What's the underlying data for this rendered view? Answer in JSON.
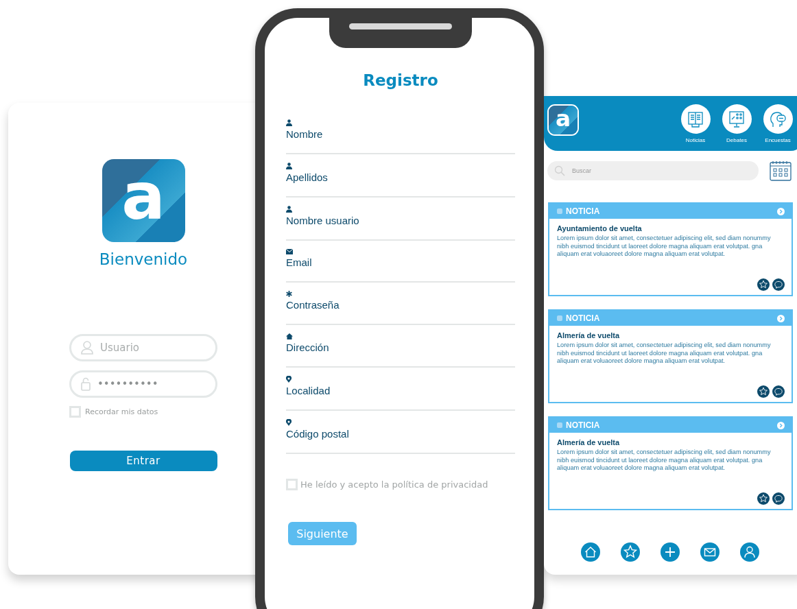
{
  "login": {
    "logo": "a",
    "title": "Bienvenido",
    "username": {
      "placeholder": "Usuario"
    },
    "password": {
      "value": "••••••••••"
    },
    "remember": {
      "label": "Recordar mis datos",
      "checked": false
    },
    "submit": "Entrar"
  },
  "register": {
    "title": "Registro",
    "fields": [
      {
        "kind": "person",
        "label": "Nombre"
      },
      {
        "kind": "person",
        "label": "Apellidos"
      },
      {
        "kind": "person",
        "label": "Nombre usuario"
      },
      {
        "kind": "mail",
        "label": "Email"
      },
      {
        "kind": "star",
        "label": "Contraseña"
      },
      {
        "kind": "home",
        "label": "Dirección"
      },
      {
        "kind": "pin",
        "label": "Localidad"
      },
      {
        "kind": "pin",
        "label": "Código postal"
      }
    ],
    "privacy": {
      "label": "He leído y acepto la política de privacidad",
      "checked": false
    },
    "next": "Siguiente"
  },
  "feed": {
    "logo": "a",
    "nav": [
      {
        "kind": "news",
        "label": "Noticias"
      },
      {
        "kind": "debate",
        "label": "Debates"
      },
      {
        "kind": "survey",
        "label": "Encuestas"
      }
    ],
    "search": {
      "placeholder": "Buscar"
    },
    "cards": [
      {
        "tag": "NOTICIA",
        "title": "Ayuntamiento de vuelta",
        "body": "Lorem ipsum dolor sit amet, consectetuer adipiscing elit, sed diam nonummy nibh euismod tincidunt ut laoreet dolore magna aliquam erat volutpat. gna aliquam erat voluaoreet dolore magna aliquam erat volutpat."
      },
      {
        "tag": "NOTICIA",
        "title": "Almería de vuelta",
        "body": "Lorem ipsum dolor sit amet, consectetuer adipiscing elit, sed diam nonummy nibh euismod tincidunt ut laoreet dolore magna aliquam erat volutpat. gna aliquam erat voluaoreet dolore magna aliquam erat volutpat."
      },
      {
        "tag": "NOTICIA",
        "title": "Almería de vuelta",
        "body": "Lorem ipsum dolor sit amet, consectetuer adipiscing elit, sed diam nonummy nibh euismod tincidunt ut laoreet dolore magna aliquam erat volutpat. gna aliquam erat voluaoreet dolore magna aliquam erat volutpat."
      }
    ]
  }
}
